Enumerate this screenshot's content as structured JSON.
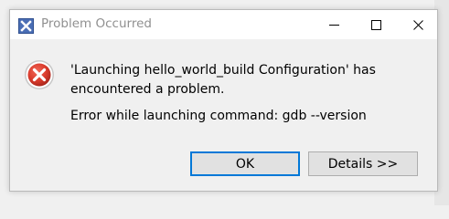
{
  "window": {
    "title": "Problem Occurred"
  },
  "message": {
    "main": "'Launching hello_world_build Configuration' has encountered a problem.",
    "detail": "Error while launching command: gdb --version"
  },
  "buttons": {
    "ok_label": "OK",
    "details_label": "Details >>"
  },
  "icons": {
    "app": "eclipse-x-icon",
    "error": "error-icon",
    "minimize": "minimize-icon",
    "maximize": "maximize-icon",
    "close": "close-icon"
  },
  "colors": {
    "error_red": "#d93a2b",
    "focus_blue": "#0078d7",
    "app_icon_blue": "#3a5a9c"
  }
}
